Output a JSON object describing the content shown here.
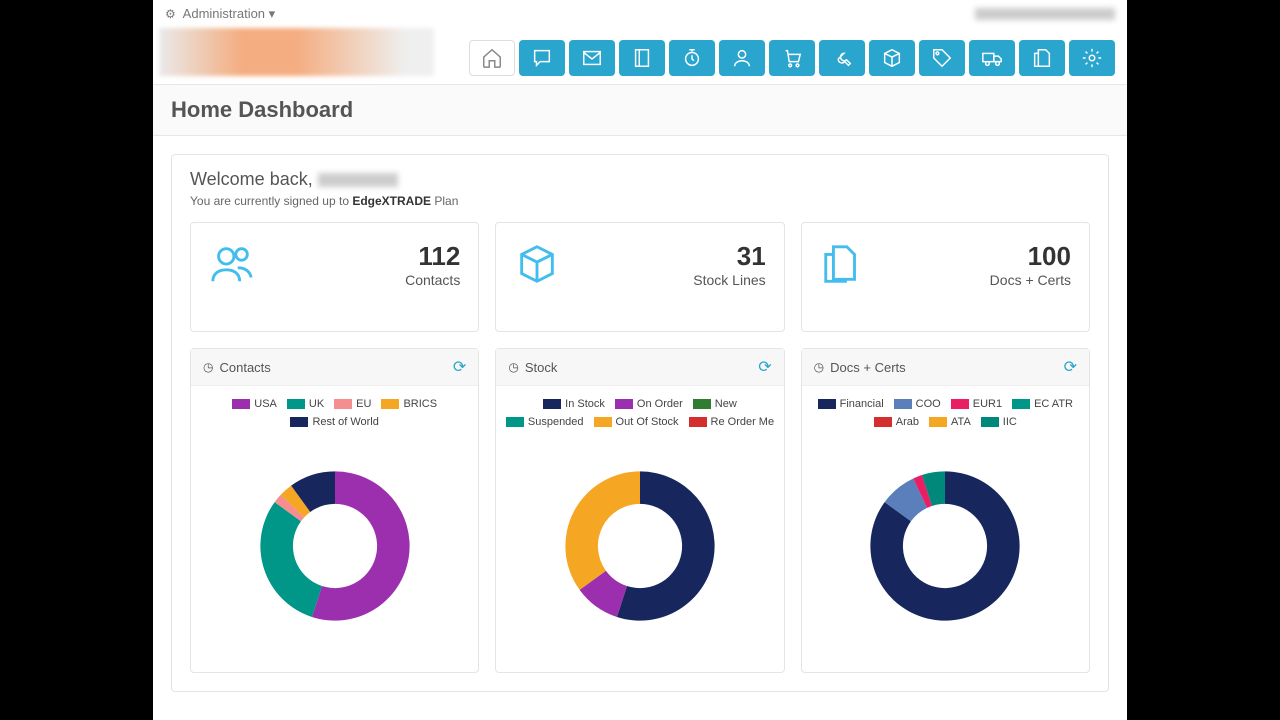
{
  "topbar": {
    "admin": "Administration"
  },
  "page_title": "Home Dashboard",
  "welcome": {
    "greeting": "Welcome back, ",
    "plan_prefix": "You are currently signed up to ",
    "plan_name": "EdgeXTRADE",
    "plan_suffix": " Plan"
  },
  "stats": {
    "contacts": {
      "value": "112",
      "label": "Contacts"
    },
    "stock": {
      "value": "31",
      "label": "Stock Lines"
    },
    "docs": {
      "value": "100",
      "label": "Docs + Certs"
    }
  },
  "panels": {
    "contacts": {
      "title": "Contacts"
    },
    "stock": {
      "title": "Stock"
    },
    "docs": {
      "title": "Docs + Certs"
    }
  },
  "colors": {
    "purple": "#9b2fae",
    "teal": "#009688",
    "pink": "#f58e8e",
    "orange": "#f5a623",
    "navy": "#17275e",
    "steel": "#5a7fbb",
    "red": "#d32f2f",
    "magenta": "#e91e63",
    "green": "#2e7d32",
    "cyan": "#00897b"
  },
  "chart_data": [
    {
      "type": "pie",
      "title": "Contacts",
      "series": [
        {
          "name": "USA",
          "value": 55,
          "color": "#9b2fae"
        },
        {
          "name": "UK",
          "value": 30,
          "color": "#009688"
        },
        {
          "name": "EU",
          "value": 2,
          "color": "#f58e8e"
        },
        {
          "name": "BRICS",
          "value": 3,
          "color": "#f5a623"
        },
        {
          "name": "Rest of World",
          "value": 10,
          "color": "#17275e"
        }
      ]
    },
    {
      "type": "pie",
      "title": "Stock",
      "series": [
        {
          "name": "In Stock",
          "value": 55,
          "color": "#17275e"
        },
        {
          "name": "On Order",
          "value": 10,
          "color": "#9b2fae"
        },
        {
          "name": "New",
          "value": 0,
          "color": "#2e7d32"
        },
        {
          "name": "Suspended",
          "value": 0,
          "color": "#009688"
        },
        {
          "name": "Out Of Stock",
          "value": 35,
          "color": "#f5a623"
        },
        {
          "name": "Re Order Me",
          "value": 0,
          "color": "#d32f2f"
        }
      ]
    },
    {
      "type": "pie",
      "title": "Docs + Certs",
      "series": [
        {
          "name": "Financial",
          "value": 85,
          "color": "#17275e"
        },
        {
          "name": "COO",
          "value": 8,
          "color": "#5a7fbb"
        },
        {
          "name": "EUR1",
          "value": 2,
          "color": "#e91e63"
        },
        {
          "name": "EC ATR",
          "value": 0,
          "color": "#009688"
        },
        {
          "name": "Arab",
          "value": 0,
          "color": "#d32f2f"
        },
        {
          "name": "ATA",
          "value": 0,
          "color": "#f5a623"
        },
        {
          "name": "IIC",
          "value": 5,
          "color": "#00897b"
        }
      ]
    }
  ]
}
